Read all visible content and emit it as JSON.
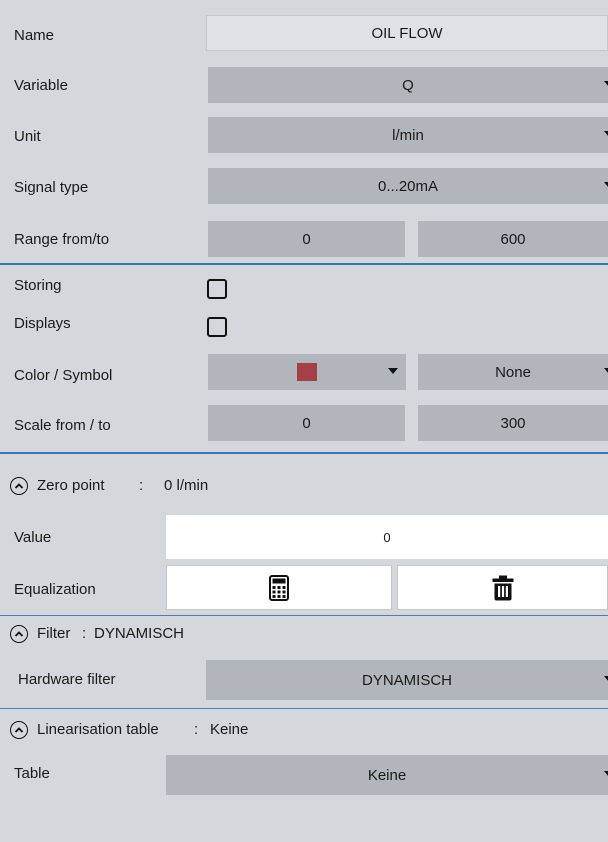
{
  "name": {
    "label": "Name",
    "value": "OIL FLOW"
  },
  "variable": {
    "label": "Variable",
    "value": "Q"
  },
  "unit": {
    "label": "Unit",
    "value": "l/min"
  },
  "signal_type": {
    "label": "Signal type",
    "value": "0...20mA"
  },
  "range": {
    "label": "Range from/to",
    "from": "0",
    "to": "600"
  },
  "storing": {
    "label": "Storing",
    "checked": false
  },
  "displays": {
    "label": "Displays",
    "checked": false
  },
  "color_symbol": {
    "label": "Color / Symbol",
    "color": "#a54146",
    "symbol": "None"
  },
  "scale": {
    "label": "Scale from / to",
    "from": "0",
    "to": "300"
  },
  "zero_point": {
    "header_label": "Zero point",
    "header_sep": ":",
    "header_value": "0 l/min",
    "value_label": "Value",
    "value": "0",
    "equalization_label": "Equalization",
    "calculator_icon": "calculator-icon",
    "trash_icon": "trash-icon"
  },
  "filter": {
    "header_label": "Filter",
    "header_sep": ":",
    "header_value": "DYNAMISCH",
    "hardware_label": "Hardware filter",
    "hardware_value": "DYNAMISCH"
  },
  "linearisation": {
    "header_label": "Linearisation table",
    "header_sep": ":",
    "header_value": "Keine",
    "table_label": "Table",
    "table_value": "Keine"
  },
  "colors": {
    "separator": "#3d74b1",
    "background": "#d4d7db",
    "field": "#b0b6bb"
  }
}
